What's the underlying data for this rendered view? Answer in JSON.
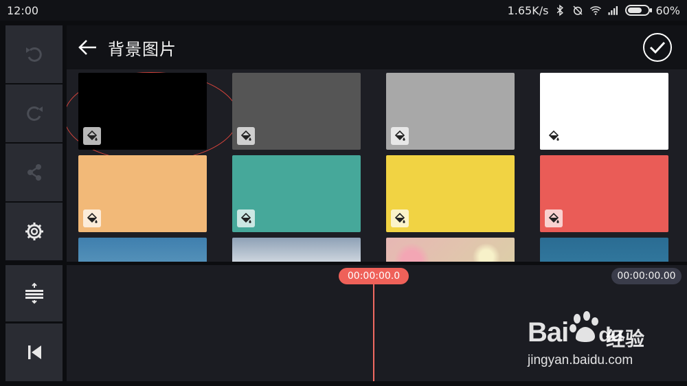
{
  "status_bar": {
    "time": "12:00",
    "network_speed": "1.65K/s",
    "battery_percent": "60%",
    "icons": [
      "bluetooth-icon",
      "alarm-off-icon",
      "wifi-icon",
      "signal-icon",
      "battery-icon"
    ]
  },
  "header": {
    "title": "背景图片",
    "back_icon": "arrow-left-icon",
    "confirm_icon": "checkmark-circle-icon"
  },
  "left_tools": [
    {
      "name": "undo",
      "icon": "undo-icon"
    },
    {
      "name": "redo",
      "icon": "redo-icon"
    },
    {
      "name": "share",
      "icon": "share-icon"
    },
    {
      "name": "settings",
      "icon": "gear-icon"
    },
    {
      "name": "adjust-layers",
      "icon": "layer-adjust-icon"
    },
    {
      "name": "jump-to-start",
      "icon": "skip-start-icon"
    }
  ],
  "swatches": [
    {
      "color": "#000000",
      "kind": "solid"
    },
    {
      "color": "#555555",
      "kind": "solid"
    },
    {
      "color": "#a8a8a8",
      "kind": "solid"
    },
    {
      "color": "#ffffff",
      "kind": "solid"
    },
    {
      "color": "#f2b978",
      "kind": "solid"
    },
    {
      "color": "#46a89a",
      "kind": "solid"
    },
    {
      "color": "#f1d343",
      "kind": "solid"
    },
    {
      "color": "#ea5c57",
      "kind": "solid"
    },
    {
      "color": "#4a8fb8",
      "kind": "image",
      "desc": "sky"
    },
    {
      "color": "#c6cbd3",
      "kind": "image",
      "desc": "clouds"
    },
    {
      "color": "#d8c79a",
      "kind": "image",
      "desc": "bokeh"
    },
    {
      "color": "#2b6f94",
      "kind": "image",
      "desc": "ocean"
    }
  ],
  "timeline": {
    "current_time": "00:00:00.0",
    "total_duration": "00:00:00.00"
  },
  "watermark": {
    "brand": "Bai",
    "brand_suffix": "du",
    "cn_text": "经验",
    "url": "jingyan.baidu.com"
  },
  "colors": {
    "accent": "#ef6159",
    "header_bg": "#111216",
    "panel_bg": "#2a2c33",
    "grid_bg": "#1d1e24"
  }
}
